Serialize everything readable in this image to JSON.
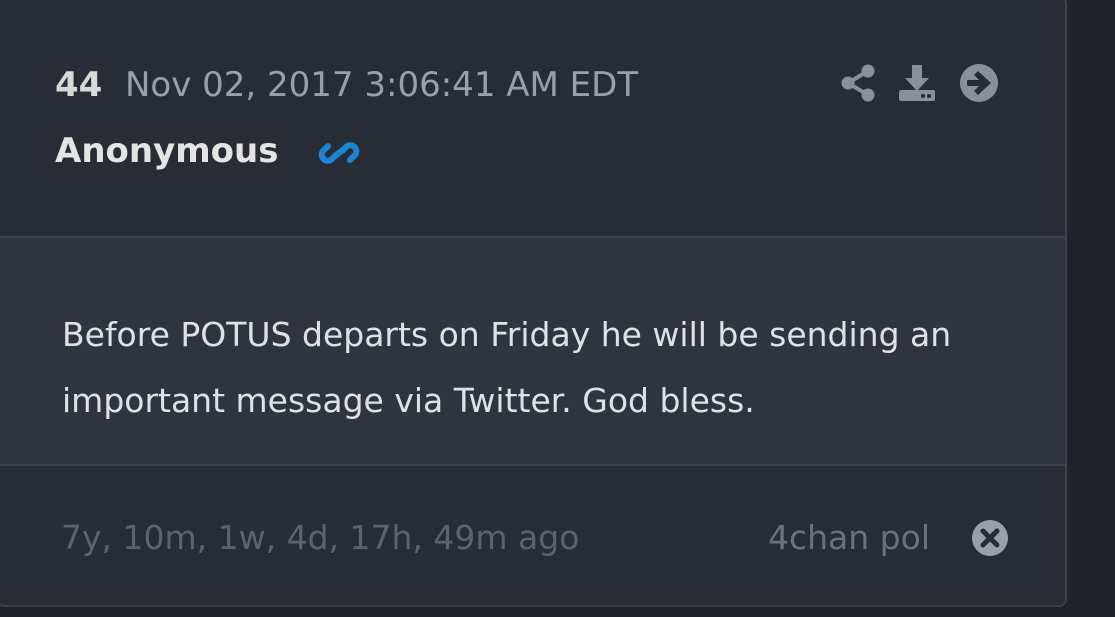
{
  "post": {
    "number": "44",
    "date": "Nov 02, 2017 3:06:41 AM EDT",
    "author": "Anonymous",
    "message": "Before POTUS departs on Friday he will be sending an important message via Twitter. God bless.",
    "time_ago": "7y, 10m, 1w, 4d, 17h, 49m ago",
    "source": "4chan pol"
  },
  "icons": {
    "link": "link-icon",
    "share": "share-icon",
    "download": "download-icon",
    "arrow": "arrow-circle-right-icon",
    "close": "close-circle-icon"
  },
  "colors": {
    "link_accent": "#1a84d6",
    "icon_muted": "#8a9099",
    "close_icon": "#9aa0aa"
  }
}
